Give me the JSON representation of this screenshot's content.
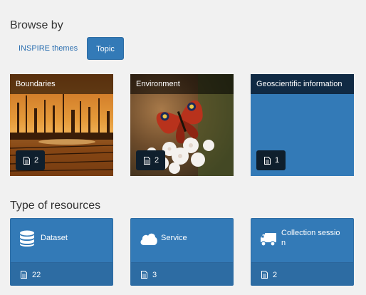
{
  "browse": {
    "title": "Browse by",
    "tabs": [
      {
        "label": "INSPIRE themes",
        "active": false
      },
      {
        "label": "Topic",
        "active": true
      }
    ],
    "topics": [
      {
        "label": "Boundaries",
        "count": "2"
      },
      {
        "label": "Environment",
        "count": "2"
      },
      {
        "label": "Geoscientific information",
        "count": "1"
      }
    ]
  },
  "resources": {
    "title": "Type of resources",
    "items": [
      {
        "label": "Dataset",
        "count": "22",
        "icon": "database-icon"
      },
      {
        "label": "Service",
        "count": "3",
        "icon": "cloud-icon"
      },
      {
        "label": "Collection sessio\nn",
        "count": "2",
        "icon": "truck-icon"
      }
    ]
  },
  "colors": {
    "primary": "#337ab7",
    "primary_dark": "#2d6ca3",
    "badge": "#0f1f2d",
    "link": "#2c6fb0",
    "background": "#f1f1f1"
  }
}
